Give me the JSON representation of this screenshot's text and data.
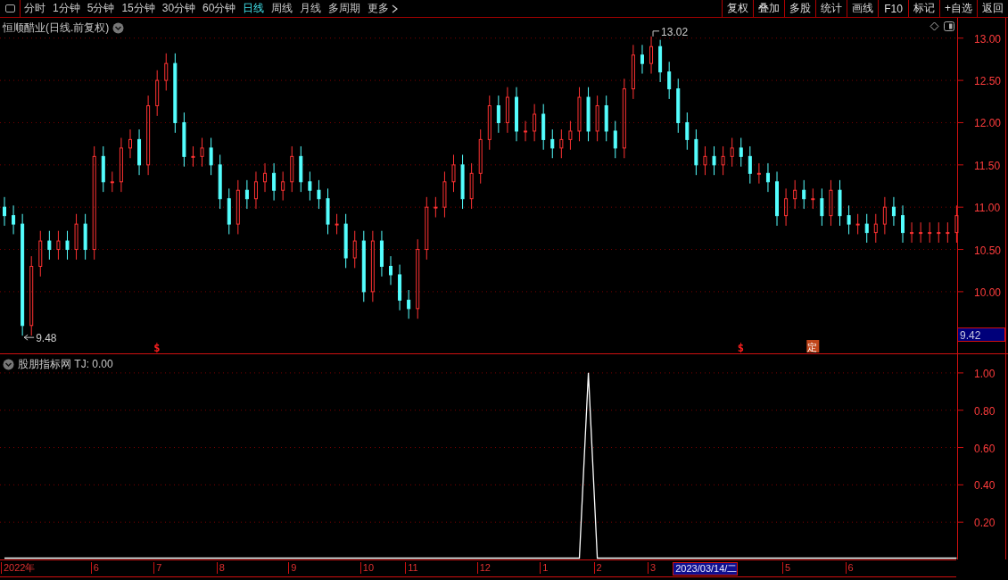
{
  "toolbar": {
    "periods": [
      {
        "label": "分时",
        "selected": false
      },
      {
        "label": "1分钟",
        "selected": false
      },
      {
        "label": "5分钟",
        "selected": false
      },
      {
        "label": "15分钟",
        "selected": false
      },
      {
        "label": "30分钟",
        "selected": false
      },
      {
        "label": "60分钟",
        "selected": false
      },
      {
        "label": "日线",
        "selected": true
      },
      {
        "label": "周线",
        "selected": false
      },
      {
        "label": "月线",
        "selected": false
      },
      {
        "label": "多周期",
        "selected": false
      },
      {
        "label": "更多",
        "selected": false
      }
    ],
    "actions": [
      "复权",
      "叠加",
      "多股",
      "统计",
      "画线",
      "F10",
      "标记",
      "+自选",
      "返回"
    ]
  },
  "main_panel": {
    "title": "恒顺醋业(日线.前复权)",
    "high_label": "13.02",
    "low_label": "9.48",
    "price_tag": "9.42",
    "markers": [
      {
        "kind": "dollar",
        "text": "$"
      },
      {
        "kind": "dollar",
        "text": "$"
      },
      {
        "kind": "ding",
        "text": "定"
      }
    ],
    "chart_data": {
      "type": "candlestick",
      "grid": true,
      "ylim": [
        9.26,
        13.24
      ],
      "yticks": [
        {
          "value": 13,
          "label": "13.00"
        },
        {
          "value": 12.5,
          "label": "12.50"
        },
        {
          "value": 12,
          "label": "12.00"
        },
        {
          "value": 11.5,
          "label": "11.50"
        },
        {
          "value": 11,
          "label": "11.00"
        },
        {
          "value": 10.5,
          "label": "10.50"
        },
        {
          "value": 10,
          "label": "10.00"
        }
      ],
      "ohlc": [
        [
          11.0,
          11.12,
          10.78,
          10.9
        ],
        [
          10.9,
          11.02,
          10.68,
          10.8
        ],
        [
          10.8,
          10.92,
          9.48,
          9.6
        ],
        [
          9.6,
          10.42,
          9.48,
          10.3
        ],
        [
          10.3,
          10.72,
          10.18,
          10.6
        ],
        [
          10.6,
          10.72,
          10.38,
          10.5
        ],
        [
          10.5,
          10.72,
          10.38,
          10.6
        ],
        [
          10.6,
          10.72,
          10.38,
          10.5
        ],
        [
          10.5,
          10.92,
          10.38,
          10.8
        ],
        [
          10.8,
          10.92,
          10.38,
          10.5
        ],
        [
          10.5,
          11.72,
          10.38,
          11.6
        ],
        [
          11.6,
          11.72,
          11.18,
          11.3
        ],
        [
          11.3,
          11.42,
          11.18,
          11.3
        ],
        [
          11.3,
          11.82,
          11.18,
          11.7
        ],
        [
          11.7,
          11.92,
          11.58,
          11.8
        ],
        [
          11.8,
          11.92,
          11.38,
          11.5
        ],
        [
          11.5,
          12.32,
          11.38,
          12.2
        ],
        [
          12.2,
          12.62,
          12.08,
          12.5
        ],
        [
          12.5,
          12.82,
          12.38,
          12.7
        ],
        [
          12.7,
          12.82,
          11.88,
          12.0
        ],
        [
          12.0,
          12.12,
          11.48,
          11.6
        ],
        [
          11.6,
          11.72,
          11.48,
          11.6
        ],
        [
          11.6,
          11.82,
          11.48,
          11.7
        ],
        [
          11.7,
          11.82,
          11.38,
          11.5
        ],
        [
          11.5,
          11.62,
          10.98,
          11.1
        ],
        [
          11.1,
          11.22,
          10.68,
          10.8
        ],
        [
          10.8,
          11.32,
          10.68,
          11.2
        ],
        [
          11.2,
          11.32,
          10.98,
          11.1
        ],
        [
          11.1,
          11.42,
          10.98,
          11.3
        ],
        [
          11.3,
          11.52,
          11.18,
          11.4
        ],
        [
          11.4,
          11.52,
          11.08,
          11.2
        ],
        [
          11.2,
          11.42,
          11.08,
          11.3
        ],
        [
          11.3,
          11.72,
          11.18,
          11.6
        ],
        [
          11.6,
          11.72,
          11.18,
          11.3
        ],
        [
          11.3,
          11.42,
          11.08,
          11.2
        ],
        [
          11.2,
          11.32,
          10.98,
          11.1
        ],
        [
          11.1,
          11.22,
          10.68,
          10.8
        ],
        [
          10.8,
          10.92,
          10.68,
          10.8
        ],
        [
          10.8,
          10.92,
          10.28,
          10.4
        ],
        [
          10.4,
          10.72,
          10.28,
          10.6
        ],
        [
          10.6,
          10.72,
          9.88,
          10.0
        ],
        [
          10.0,
          10.72,
          9.88,
          10.6
        ],
        [
          10.6,
          10.72,
          10.18,
          10.3
        ],
        [
          10.3,
          10.42,
          10.08,
          10.2
        ],
        [
          10.2,
          10.32,
          9.78,
          9.9
        ],
        [
          9.9,
          10.02,
          9.68,
          9.8
        ],
        [
          9.8,
          10.62,
          9.68,
          10.5
        ],
        [
          10.5,
          11.12,
          10.38,
          11.0
        ],
        [
          11.0,
          11.12,
          10.88,
          11.0
        ],
        [
          11.0,
          11.42,
          10.88,
          11.3
        ],
        [
          11.3,
          11.62,
          11.18,
          11.5
        ],
        [
          11.5,
          11.62,
          10.98,
          11.1
        ],
        [
          11.1,
          11.52,
          10.98,
          11.4
        ],
        [
          11.4,
          11.92,
          11.28,
          11.8
        ],
        [
          11.8,
          12.32,
          11.68,
          12.2
        ],
        [
          12.2,
          12.32,
          11.88,
          12.0
        ],
        [
          12.0,
          12.42,
          11.88,
          12.3
        ],
        [
          12.3,
          12.42,
          11.78,
          11.9
        ],
        [
          11.9,
          12.02,
          11.78,
          11.9
        ],
        [
          11.9,
          12.22,
          11.78,
          12.1
        ],
        [
          12.1,
          12.22,
          11.68,
          11.8
        ],
        [
          11.8,
          11.92,
          11.58,
          11.7
        ],
        [
          11.7,
          11.92,
          11.58,
          11.8
        ],
        [
          11.8,
          12.02,
          11.68,
          11.9
        ],
        [
          11.9,
          12.42,
          11.78,
          12.3
        ],
        [
          12.3,
          12.42,
          11.78,
          11.9
        ],
        [
          11.9,
          12.32,
          11.78,
          12.2
        ],
        [
          12.2,
          12.32,
          11.78,
          11.9
        ],
        [
          11.9,
          12.02,
          11.58,
          11.7
        ],
        [
          11.7,
          12.52,
          11.58,
          12.4
        ],
        [
          12.4,
          12.92,
          12.28,
          12.8
        ],
        [
          12.8,
          12.92,
          12.58,
          12.7
        ],
        [
          12.7,
          13.02,
          12.58,
          12.9
        ],
        [
          12.9,
          12.98,
          12.48,
          12.6
        ],
        [
          12.6,
          12.72,
          12.28,
          12.4
        ],
        [
          12.4,
          12.52,
          11.88,
          12.0
        ],
        [
          12.0,
          12.12,
          11.68,
          11.8
        ],
        [
          11.8,
          11.92,
          11.38,
          11.5
        ],
        [
          11.5,
          11.72,
          11.38,
          11.6
        ],
        [
          11.6,
          11.72,
          11.38,
          11.5
        ],
        [
          11.5,
          11.72,
          11.38,
          11.6
        ],
        [
          11.6,
          11.82,
          11.48,
          11.7
        ],
        [
          11.7,
          11.82,
          11.48,
          11.6
        ],
        [
          11.6,
          11.72,
          11.28,
          11.4
        ],
        [
          11.4,
          11.52,
          11.28,
          11.4
        ],
        [
          11.4,
          11.52,
          11.18,
          11.3
        ],
        [
          11.3,
          11.42,
          10.78,
          10.9
        ],
        [
          10.9,
          11.22,
          10.78,
          11.1
        ],
        [
          11.1,
          11.32,
          10.98,
          11.2
        ],
        [
          11.2,
          11.32,
          10.98,
          11.1
        ],
        [
          11.1,
          11.22,
          10.98,
          11.1
        ],
        [
          11.1,
          11.22,
          10.78,
          10.9
        ],
        [
          10.9,
          11.32,
          10.78,
          11.2
        ],
        [
          11.2,
          11.32,
          10.78,
          10.9
        ],
        [
          10.9,
          11.02,
          10.68,
          10.8
        ],
        [
          10.8,
          10.92,
          10.68,
          10.8
        ],
        [
          10.8,
          10.92,
          10.58,
          10.7
        ],
        [
          10.7,
          10.92,
          10.58,
          10.8
        ],
        [
          10.8,
          11.12,
          10.68,
          11.0
        ],
        [
          11.0,
          11.12,
          10.78,
          10.9
        ],
        [
          10.9,
          11.02,
          10.58,
          10.7
        ],
        [
          10.7,
          10.82,
          10.58,
          10.7
        ],
        [
          10.7,
          10.82,
          10.58,
          10.7
        ],
        [
          10.7,
          10.82,
          10.58,
          10.7
        ],
        [
          10.7,
          10.82,
          10.58,
          10.7
        ],
        [
          10.7,
          10.82,
          10.58,
          10.7
        ],
        [
          10.7,
          11.02,
          10.58,
          10.9
        ]
      ]
    }
  },
  "indicator_panel": {
    "title": "股朋指标网 TJ: 0.00",
    "chart_data": {
      "type": "line",
      "grid": true,
      "ylim": [
        0,
        1.1
      ],
      "yticks": [
        {
          "value": 1,
          "label": "1.00"
        },
        {
          "value": 0.8,
          "label": "0.80"
        },
        {
          "value": 0.6,
          "label": "0.60"
        },
        {
          "value": 0.4,
          "label": "0.40"
        },
        {
          "value": 0.2,
          "label": "0.20"
        }
      ],
      "series": [
        {
          "color": "#ffffff",
          "values": [
            0,
            0,
            0,
            0,
            0,
            0,
            0,
            0,
            0,
            0,
            0,
            0,
            0,
            0,
            0,
            0,
            0,
            0,
            0,
            0,
            0,
            0,
            0,
            0,
            0,
            0,
            0,
            0,
            0,
            0,
            0,
            0,
            0,
            0,
            0,
            0,
            0,
            0,
            0,
            0,
            0,
            0,
            0,
            0,
            0,
            0,
            0,
            0,
            0,
            0,
            0,
            0,
            0,
            0,
            0,
            0,
            0,
            0,
            0,
            0,
            0,
            0,
            0,
            0,
            0,
            1,
            0,
            0,
            0,
            0,
            0,
            0,
            0,
            0,
            0,
            0,
            0,
            0,
            0,
            0,
            0,
            0,
            0,
            0,
            0,
            0,
            0,
            0,
            0,
            0,
            0,
            0,
            0,
            0,
            0,
            0,
            0,
            0,
            0,
            0,
            0,
            0,
            0,
            0,
            0,
            0,
            0
          ]
        }
      ]
    },
    "date_labels": [
      "2022年",
      "6",
      "7",
      "8",
      "9",
      "10",
      "11",
      "12",
      "1",
      "2",
      "3",
      "5",
      "6"
    ],
    "cursor_date": "2023/03/14/二"
  }
}
